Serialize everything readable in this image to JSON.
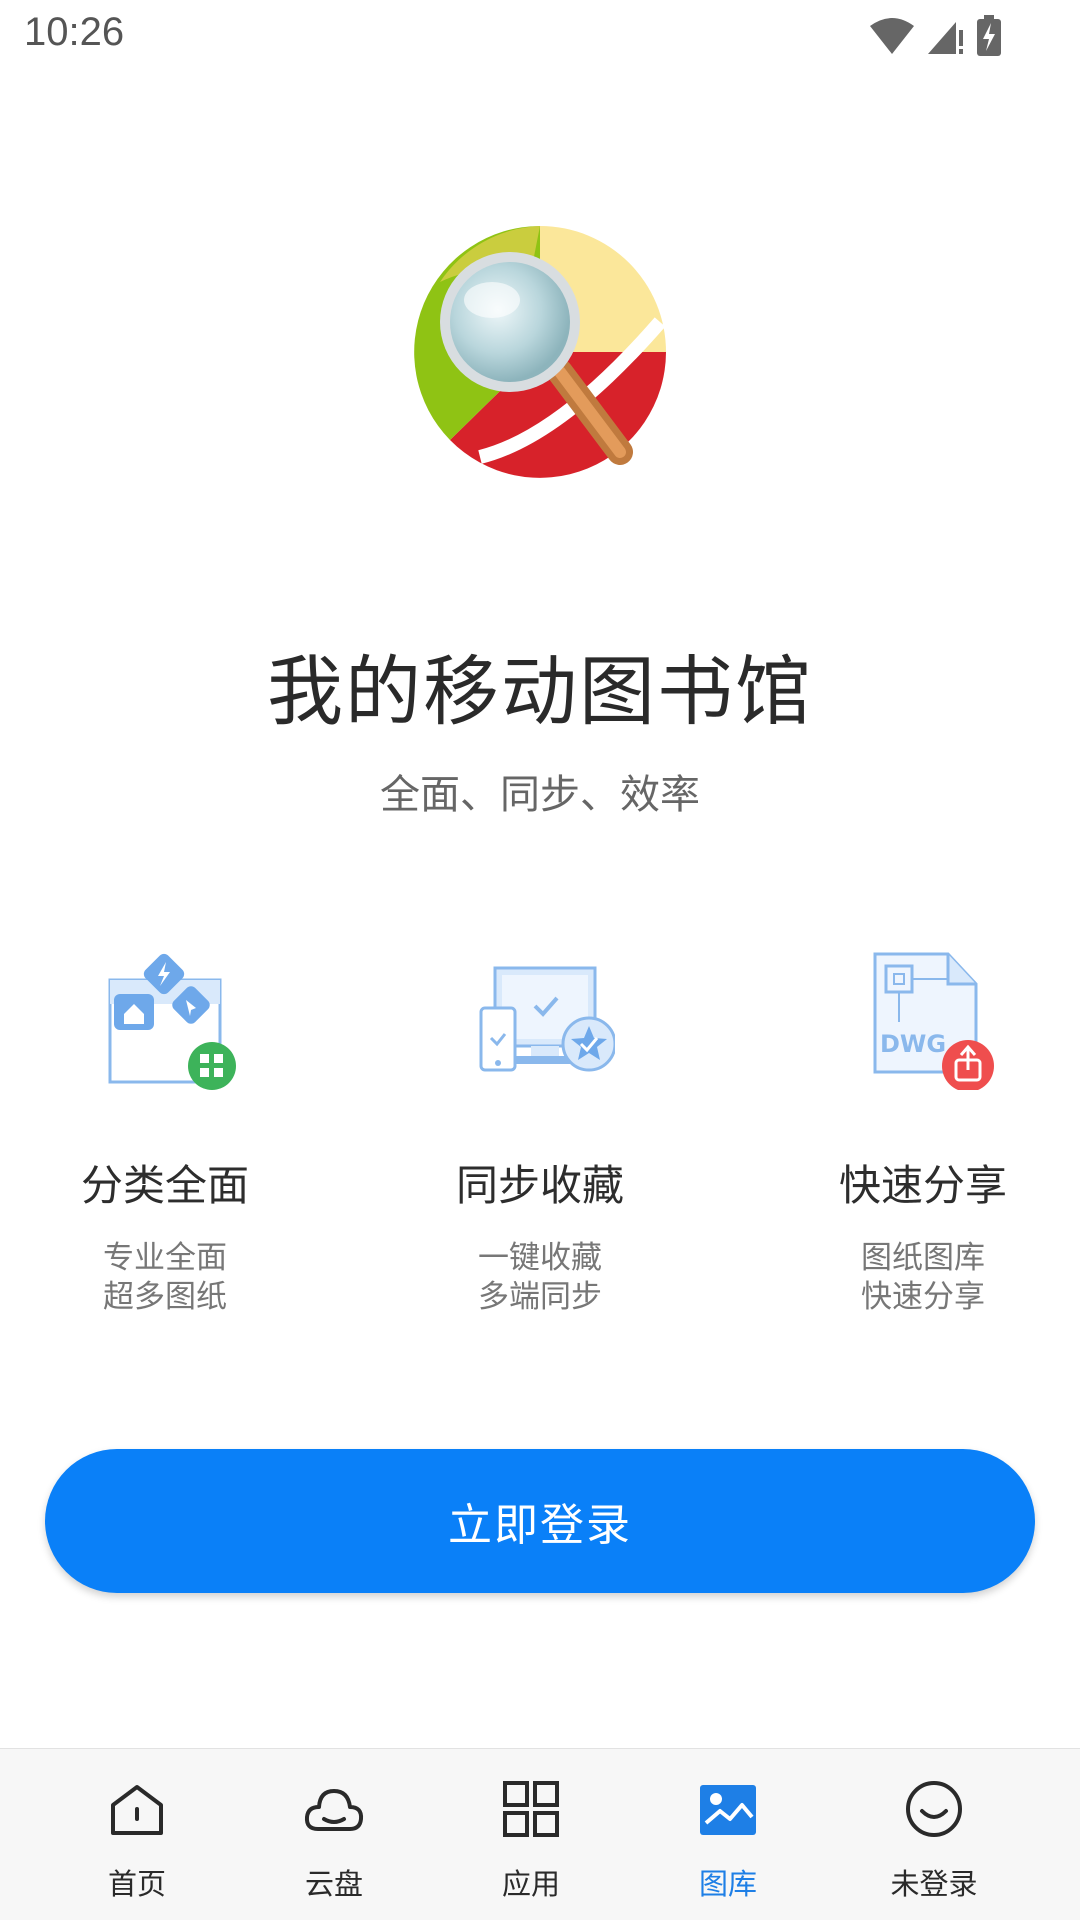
{
  "status_bar": {
    "time": "10:26"
  },
  "hero": {
    "title": "我的移动图书馆",
    "subtitle": "全面、同步、效率"
  },
  "features": [
    {
      "icon": "category-folder-icon",
      "title": "分类全面",
      "line1": "专业全面",
      "line2": "超多图纸"
    },
    {
      "icon": "sync-devices-icon",
      "title": "同步收藏",
      "line1": "一键收藏",
      "line2": "多端同步"
    },
    {
      "icon": "dwg-share-icon",
      "title": "快速分享",
      "line1": "图纸图库",
      "line2": "快速分享",
      "badge_text": "DWG"
    }
  ],
  "login_button": {
    "label": "立即登录",
    "color": "#0a80f8"
  },
  "bottom_nav": {
    "active_color": "#1e7fe6",
    "items": [
      {
        "icon": "home-icon",
        "label": "首页"
      },
      {
        "icon": "cloud-icon",
        "label": "云盘"
      },
      {
        "icon": "apps-grid-icon",
        "label": "应用"
      },
      {
        "icon": "gallery-icon",
        "label": "图库",
        "active": true
      },
      {
        "icon": "user-face-icon",
        "label": "未登录"
      }
    ]
  }
}
